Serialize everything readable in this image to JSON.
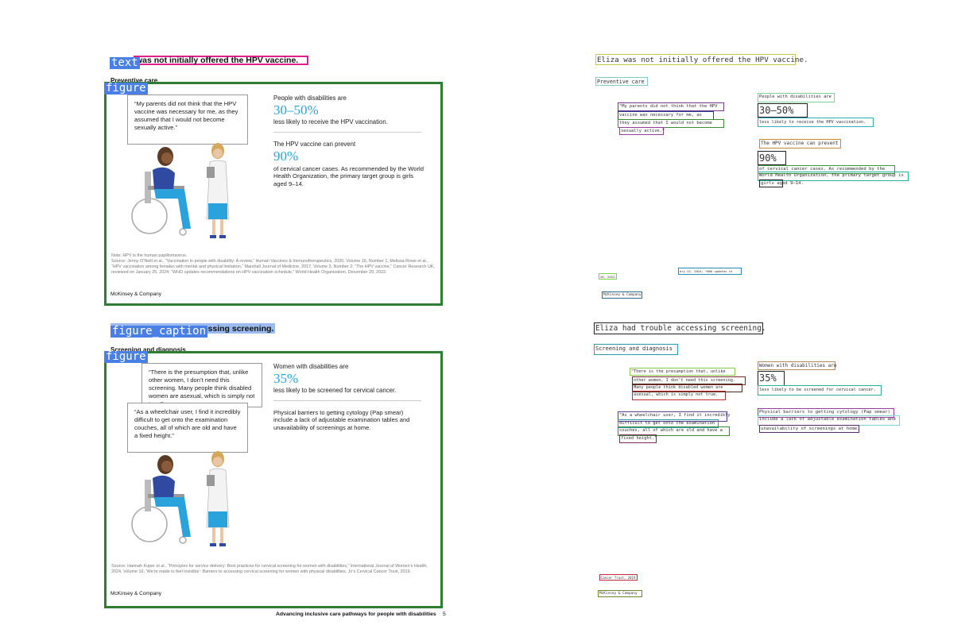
{
  "left": {
    "label_text": "text",
    "label_figure": "figure",
    "label_figure_caption": "figure_caption",
    "section1": {
      "heading": "was not initially offered the HPV vaccine.",
      "subheading": "Preventive care",
      "quote": "“My parents did not think that the HPV vaccine was necessary for me, as they assumed that I would not become sexually active.”",
      "stat1_label": "People with disabilities are",
      "stat1_value": "30–50%",
      "stat1_text": "less likely to receive the HPV vaccination.",
      "stat2_label": "The HPV vaccine can prevent",
      "stat2_value": "90%",
      "stat2_text": "of cervical cancer cases. As recommended by the World Health Organization, the primary target group is girls aged 9–14.",
      "note": "Note: HPV is the human papillomavirus.",
      "source": "Source: Jenny O’Neill et al., “Vaccination in people with disability: A review,” Human Vaccines & Immunotherapeutics, 2020, Volume 16, Number 1; Melissa Rowe et al., “HPV vaccination among females with mental and physical limitation,” Marshall Journal of Medicine, 2017, Volume 3, Number 2; “The HPV vaccine,” Cancer Research UK, reviewed on January 25, 2024; “WHO updates recommendations on HPV vaccination schedule,” World Health Organization, December 20, 2022.",
      "brand": "McKinsey & Company"
    },
    "section2": {
      "heading": "ccessing screening.",
      "subheading": "Screening and diagnosis",
      "quote1": "“There is the presumption that, unlike other women, I don’t need this screening. Many people think disabled women are asexual, which is simply not true.”",
      "quote2": "“As a wheelchair user, I find it incredibly difficult to get onto the examination couches, all of which are old and have a fixed height.”",
      "stat1_label": "Women with disabilities are",
      "stat1_value": "35%",
      "stat1_text": "less likely to be screened for cervical cancer.",
      "stat2_text": "Physical barriers to getting cytology (Pap smear) include a lack of adjustable examination tables and unavailability of screenings at home.",
      "source": "Source: Hannah Kuper et al., “Principles for service delivery: Best practices for cervical screening for women with disabilities,” International Journal of Women’s Health, 2024, Volume 16; ‘We’re made to feel invisible’: Barriers to accessing cervical screening for women with physical disabilities, Jo’s Cervical Cancer Trust, 2019.",
      "brand": "McKinsey & Company"
    },
    "footer": "Advancing inclusive care pathways for people with disabilities",
    "page_number": "5"
  },
  "right": {
    "s1_title": "Eliza was not initially offered the HPV vaccine.",
    "s1_sub": "Preventive care",
    "s1_q1": "“My parents did not think that the HPV",
    "s1_q2": "vaccine was necessary for me, as",
    "s1_q3": "they assumed that I would not become",
    "s1_q4": "sexually active.”",
    "s1_st1_label": "People with disabilities are",
    "s1_st1_value": "30–50%",
    "s1_st1_text": "less likely to receive the HPV vaccination.",
    "s1_st2_label": "The HPV vaccine can prevent",
    "s1_st2_value": "90%",
    "s1_st2_t1": "of cervical cancer cases. As recommended by the",
    "s1_st2_t2": "World Health Organization, the primary target group is",
    "s1_st2_t3": "girls aged 9–14.",
    "s1_src1": "ary 25, 2024; “WHO updates re",
    "s1_src2": "20, 2022.",
    "s1_brand": "McKinsey & Company",
    "s2_title": "Eliza had trouble accessing screening.",
    "s2_sub": "Screening and diagnosis",
    "s2_q1a": "“There is the presumption that, unlike",
    "s2_q1b": "other women, I don’t need this screening.",
    "s2_q1c": "Many people think disabled women are",
    "s2_q1d": "asexual, which is simply not true.",
    "s2_q2a": "“As a wheelchair user, I find it incredibly",
    "s2_q2b": "difficult to get onto the examination",
    "s2_q2c": "couches, all of which are old and have a",
    "s2_q2d": "fixed height.”",
    "s2_st1_label": "Women with disabilities are",
    "s2_st1_value": "35%",
    "s2_st1_text": "less likely to be screened for cervical cancer.",
    "s2_st2_t1": "Physical barriers to getting cytology (Pap smear)",
    "s2_st2_t2": "include a lack of adjustable examination tables and",
    "s2_st2_t3": "unavailability of screenings at home.",
    "s2_src": "Cancer Trust, 2019",
    "s2_brand": "McKinsey & Company"
  },
  "colors": {
    "label_blue": "#4a7fe6",
    "figure_green": "#2e7d32",
    "accent_blue": "#2aa3dd",
    "heading_pink": "#e0208c"
  }
}
